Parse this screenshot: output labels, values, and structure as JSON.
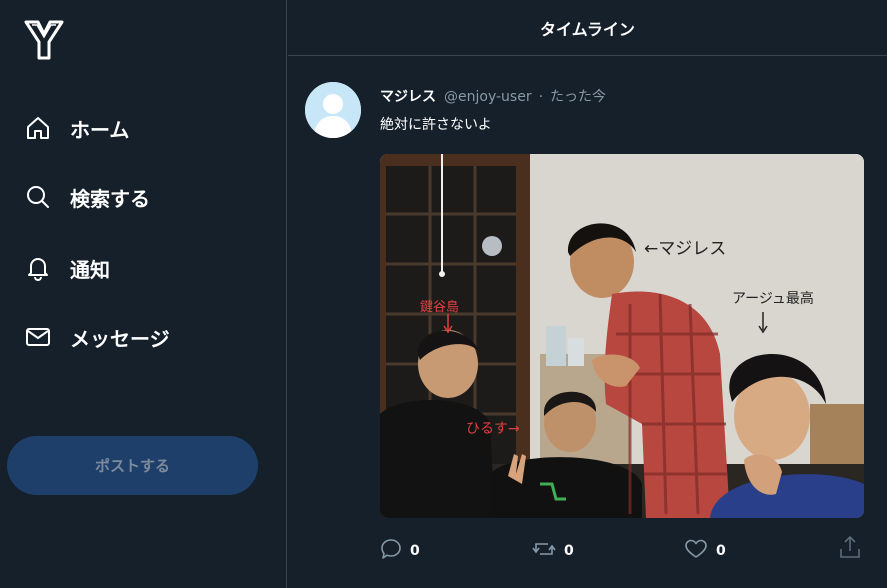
{
  "sidebar": {
    "logo_icon": "y-logo-icon",
    "items": [
      {
        "label": "ホーム",
        "icon": "home-icon"
      },
      {
        "label": "検索する",
        "icon": "search-icon"
      },
      {
        "label": "通知",
        "icon": "bell-icon"
      },
      {
        "label": "メッセージ",
        "icon": "mail-icon"
      }
    ],
    "post_button_label": "ポストする"
  },
  "header": {
    "title": "タイムライン"
  },
  "post": {
    "user_name": "マジレス",
    "handle": "@enjoy-user",
    "separator": "·",
    "time": "たった今",
    "text": "絶対に許さないよ",
    "photo_annotations": {
      "majires": "←マジレス",
      "aju": "アージュ最高",
      "left_top": "鍵谷島",
      "hirusu": "ひるす→"
    },
    "actions": {
      "reply_count": "0",
      "repost_count": "0",
      "like_count": "0"
    }
  },
  "colors": {
    "background": "#15202b",
    "border": "#38444d",
    "muted_text": "#8899a6",
    "post_button_bg": "#1f3f6b"
  }
}
